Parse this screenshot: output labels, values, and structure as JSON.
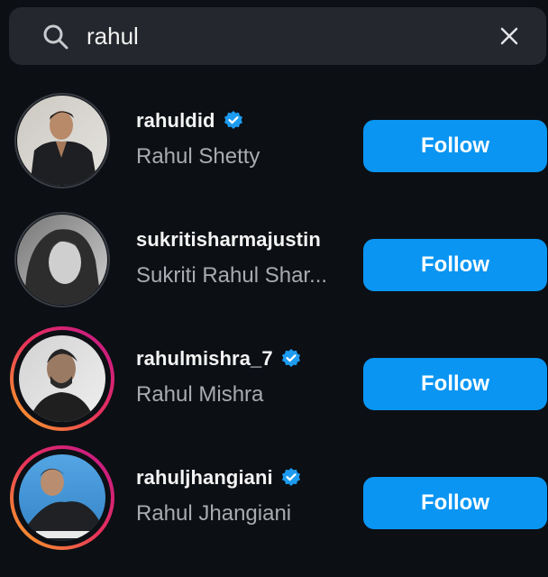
{
  "search": {
    "query": "rahul",
    "search_icon": "search-icon",
    "clear_icon": "close-icon"
  },
  "colors": {
    "background": "#0c0f14",
    "search_bg": "#24272d",
    "follow_button": "#0a95f2",
    "verified_badge": "#1d9bf0",
    "secondary_text": "#a9abb0"
  },
  "results": [
    {
      "username": "rahuldid",
      "verified": true,
      "full_name": "Rahul Shetty",
      "follow_label": "Follow",
      "story_ring": false
    },
    {
      "username": "sukritisharmajustin",
      "verified": false,
      "full_name": "Sukriti Rahul Shar...",
      "follow_label": "Follow",
      "story_ring": false
    },
    {
      "username": "rahulmishra_7",
      "verified": true,
      "full_name": "Rahul Mishra",
      "follow_label": "Follow",
      "story_ring": true
    },
    {
      "username": "rahuljhangiani",
      "verified": true,
      "full_name": "Rahul Jhangiani",
      "follow_label": "Follow",
      "story_ring": true
    }
  ]
}
